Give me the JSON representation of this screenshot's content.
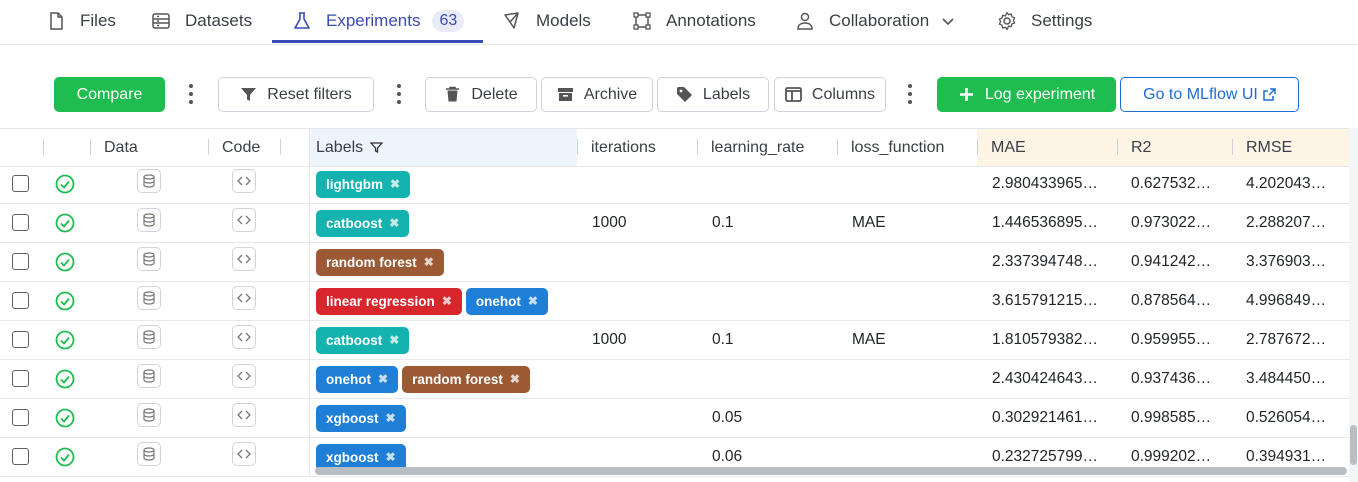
{
  "nav": {
    "files": "Files",
    "datasets": "Datasets",
    "experiments": "Experiments",
    "experiments_count": "63",
    "models": "Models",
    "annotations": "Annotations",
    "collaboration": "Collaboration",
    "settings": "Settings"
  },
  "toolbar": {
    "compare": "Compare",
    "reset_filters": "Reset filters",
    "delete": "Delete",
    "archive": "Archive",
    "labels": "Labels",
    "columns": "Columns",
    "log_experiment": "Log experiment",
    "mlflow": "Go to MLflow UI"
  },
  "table": {
    "headers": {
      "data": "Data",
      "code": "Code",
      "labels": "Labels",
      "iterations": "iterations",
      "learning_rate": "learning_rate",
      "loss_function": "loss_function",
      "mae": "MAE",
      "r2": "R2",
      "rmse": "RMSE"
    },
    "rows": [
      {
        "labels": [
          {
            "text": "lightgbm",
            "color": "teal"
          }
        ],
        "iterations": "",
        "learning_rate": "",
        "loss_function": "",
        "mae": "2.980433965…",
        "r2": "0.627532…",
        "rmse": "4.202043…"
      },
      {
        "labels": [
          {
            "text": "catboost",
            "color": "teal"
          }
        ],
        "iterations": "1000",
        "learning_rate": "0.1",
        "loss_function": "MAE",
        "mae": "1.446536895…",
        "r2": "0.973022…",
        "rmse": "2.288207…"
      },
      {
        "labels": [
          {
            "text": "random forest",
            "color": "brown"
          }
        ],
        "iterations": "",
        "learning_rate": "",
        "loss_function": "",
        "mae": "2.337394748…",
        "r2": "0.941242…",
        "rmse": "3.376903…"
      },
      {
        "labels": [
          {
            "text": "linear regression",
            "color": "red"
          },
          {
            "text": "onehot",
            "color": "blue"
          }
        ],
        "iterations": "",
        "learning_rate": "",
        "loss_function": "",
        "mae": "3.615791215…",
        "r2": "0.878564…",
        "rmse": "4.996849…"
      },
      {
        "labels": [
          {
            "text": "catboost",
            "color": "teal"
          }
        ],
        "iterations": "1000",
        "learning_rate": "0.1",
        "loss_function": "MAE",
        "mae": "1.810579382…",
        "r2": "0.959955…",
        "rmse": "2.787672…"
      },
      {
        "labels": [
          {
            "text": "onehot",
            "color": "blue"
          },
          {
            "text": "random forest",
            "color": "brown"
          }
        ],
        "iterations": "",
        "learning_rate": "",
        "loss_function": "",
        "mae": "2.430424643…",
        "r2": "0.937436…",
        "rmse": "3.484450…"
      },
      {
        "labels": [
          {
            "text": "xgboost",
            "color": "blue"
          }
        ],
        "iterations": "",
        "learning_rate": "0.05",
        "loss_function": "",
        "mae": "0.302921461…",
        "r2": "0.998585…",
        "rmse": "0.526054…"
      },
      {
        "labels": [
          {
            "text": "xgboost",
            "color": "blue"
          }
        ],
        "iterations": "",
        "learning_rate": "0.06",
        "loss_function": "",
        "mae": "0.232725799…",
        "r2": "0.999202…",
        "rmse": "0.394931…"
      }
    ]
  },
  "colors": {
    "accent": "#3a4bb5",
    "green": "#1fbd4f",
    "link_blue": "#1c6fd1",
    "tag_teal": "#14b3b0",
    "tag_brown": "#9c5a34",
    "tag_red": "#d8262c",
    "tag_blue": "#1f7fd6"
  },
  "icons": {
    "files": "file-icon",
    "datasets": "dataset-icon",
    "experiments": "flask-icon",
    "models": "model-icon",
    "annotations": "annotation-icon",
    "collaboration": "users-icon",
    "settings": "gear-icon"
  }
}
